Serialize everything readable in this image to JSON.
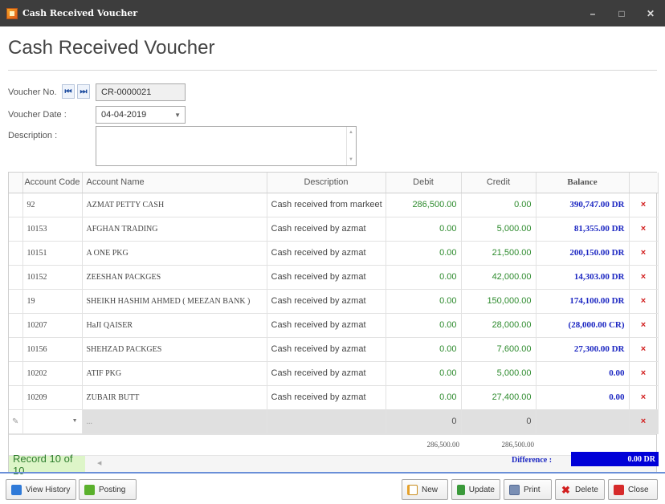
{
  "window": {
    "title": "Cash Received Voucher",
    "minimize_glyph": "–",
    "maximize_glyph": "□",
    "close_glyph": "✕"
  },
  "heading": "Cash Received Voucher",
  "form": {
    "voucher_no_label": "Voucher No.",
    "voucher_no_value": "CR-0000021",
    "first_glyph": "⏮",
    "last_glyph": "⏭",
    "voucher_date_label": "Voucher Date :",
    "voucher_date_value": "04-04-2019",
    "description_label": "Description :",
    "description_value": ""
  },
  "grid": {
    "columns": [
      "Account Code",
      "Account Name",
      "Description",
      "Debit",
      "Credit",
      "Balance"
    ],
    "rows": [
      {
        "code": "92",
        "name": "AZMAT PETTY CASH",
        "desc": "Cash received from markeet",
        "debit": "286,500.00",
        "credit": "0.00",
        "balance": "390,747.00 DR"
      },
      {
        "code": "10153",
        "name": "AFGHAN TRADING",
        "desc": "Cash received by azmat",
        "debit": "0.00",
        "credit": "5,000.00",
        "balance": "81,355.00 DR"
      },
      {
        "code": "10151",
        "name": "A ONE PKG",
        "desc": "Cash received by azmat",
        "debit": "0.00",
        "credit": "21,500.00",
        "balance": "200,150.00 DR"
      },
      {
        "code": "10152",
        "name": "ZEESHAN PACKGES",
        "desc": "Cash received by azmat",
        "debit": "0.00",
        "credit": "42,000.00",
        "balance": "14,303.00 DR"
      },
      {
        "code": "19",
        "name": "SHEIKH HASHIM AHMED ( MEEZAN BANK )",
        "desc": "Cash received by azmat",
        "debit": "0.00",
        "credit": "150,000.00",
        "balance": "174,100.00 DR"
      },
      {
        "code": "10207",
        "name": "HaJI QAISER",
        "desc": "Cash received by azmat",
        "debit": "0.00",
        "credit": "28,000.00",
        "balance": "(28,000.00 CR)"
      },
      {
        "code": "10156",
        "name": "SHEHZAD PACKGES",
        "desc": "Cash received by azmat",
        "debit": "0.00",
        "credit": "7,600.00",
        "balance": "27,300.00 DR"
      },
      {
        "code": "10202",
        "name": "ATIF PKG",
        "desc": "Cash received by azmat",
        "debit": "0.00",
        "credit": "5,000.00",
        "balance": "0.00"
      },
      {
        "code": "10209",
        "name": "ZUBAIR BUTT",
        "desc": "Cash received by azmat",
        "debit": "0.00",
        "credit": "27,400.00",
        "balance": "0.00"
      }
    ],
    "new_row": {
      "name": "...",
      "debit": "0",
      "credit": "0"
    },
    "total_debit": "286,500.00",
    "total_credit": "286,500.00",
    "record_text": "Record 10 of 10",
    "delete_glyph": "×"
  },
  "difference": {
    "label": "Difference :",
    "value": "0.00 DR"
  },
  "buttons": {
    "view_history": "View History",
    "posting": "Posting",
    "new": "New",
    "update": "Update",
    "print": "Print",
    "delete": "Delete",
    "close": "Close"
  },
  "colors": {
    "titlebar": "#3d3d3d",
    "balance": "#1c27c2",
    "amount": "#2e8b2e",
    "delete": "#d21f1f",
    "difference_bg": "#0000d8",
    "record_bg": "#ddf5c8"
  }
}
